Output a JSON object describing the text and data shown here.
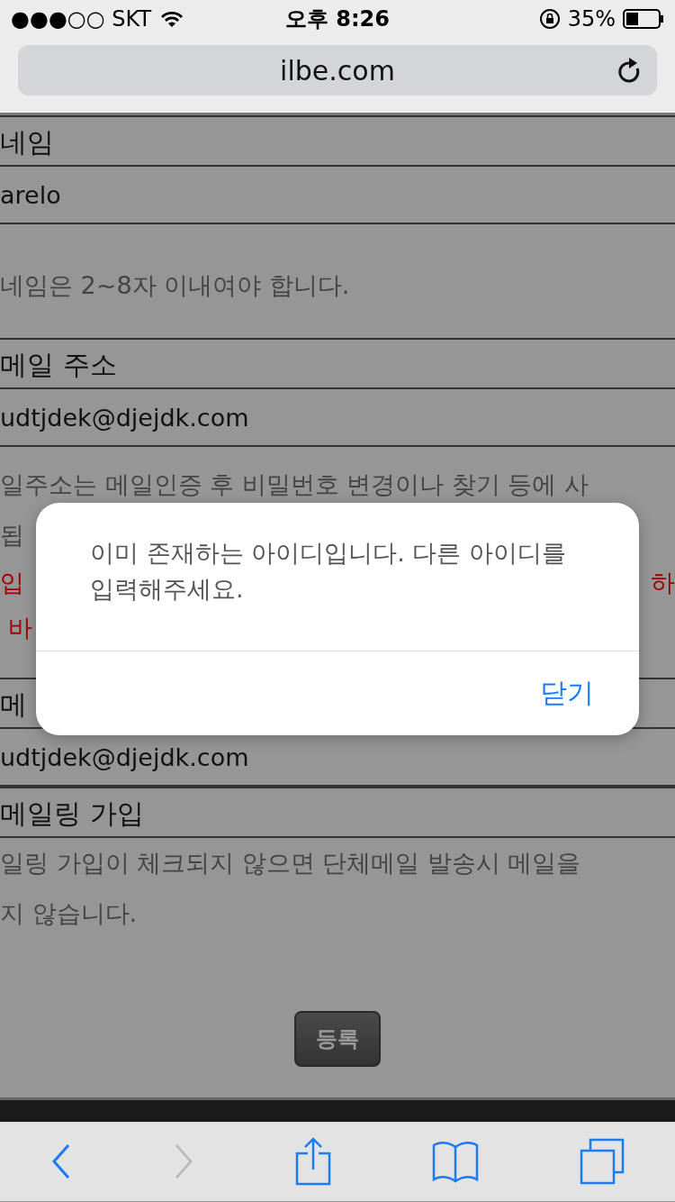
{
  "status_bar": {
    "carrier": "●●●○○ SKT",
    "time": "오후 8:26",
    "battery": "35%"
  },
  "address_bar": {
    "url": "ilbe.com"
  },
  "page": {
    "lines": [
      {
        "kind": "label",
        "parts": [
          "네임"
        ]
      },
      {
        "kind": "input",
        "parts": [
          "arelo"
        ]
      },
      {
        "kind": "help",
        "parts": [
          "네임은 2~8자 이내여야 합니다."
        ]
      },
      {
        "kind": "label",
        "parts": [
          "메일 주소"
        ]
      },
      {
        "kind": "input",
        "parts": [
          "udtjdek@djejdk.com"
        ]
      },
      {
        "kind": "help",
        "parts": [
          "일주소는 메일인증 후 비밀번호 변경이나 찾기 등에 사"
        ]
      },
      {
        "kind": "help",
        "parts": [
          "됩"
        ]
      },
      {
        "kind": "warning",
        "parts": [
          "입",
          "하"
        ]
      },
      {
        "kind": "warning",
        "parts": [
          " 바"
        ]
      },
      {
        "kind": "label",
        "parts": [
          "메"
        ]
      },
      {
        "kind": "input",
        "parts": [
          "udtjdek@djejdk.com"
        ]
      },
      {
        "kind": "label",
        "parts": [
          "메일링 가입"
        ]
      },
      {
        "kind": "help",
        "parts": [
          "일링 가입이 체크되지 않으면 단체메일 발송시 메일을"
        ]
      },
      {
        "kind": "help",
        "parts": [
          "지 않습니다."
        ]
      },
      {
        "kind": "button",
        "parts": [
          "등록"
        ]
      }
    ]
  },
  "dialog": {
    "message": "이미 존재하는 아이디입니다. 다른 아이디를 입력해주세요.",
    "button": "닫기"
  },
  "toolbar": {
    "back": {
      "disabled": false
    },
    "forward": {
      "disabled": true
    }
  }
}
